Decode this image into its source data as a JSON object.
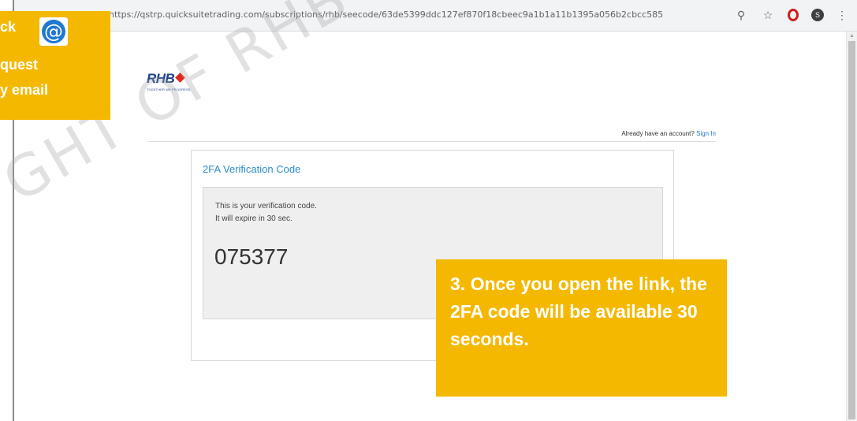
{
  "browser": {
    "url": "https://qstrp.quicksuitetrading.com/subscriptions/rhb/seecode/63de5399ddc127ef870f18cbeec9a1b1a11b1395a056b2cbcc585",
    "profile_initial": "S"
  },
  "logo": {
    "word": "RHB",
    "tagline": "TOGETHER WE PROGRESS"
  },
  "header": {
    "prompt": "Already have an account?",
    "signin": "Sign In"
  },
  "card": {
    "title": "2FA Verification Code",
    "line1": "This is your verification code.",
    "line2": "It will expire in 30 sec.",
    "code": "075377"
  },
  "watermark": "GHT OF RHB INVEST",
  "callouts": {
    "left_lines": [
      "ck",
      "quest",
      "y email"
    ],
    "right_text": "3. Once you open the link, the 2FA code will be available 30 seconds."
  },
  "colors": {
    "callout": "#f5b800",
    "accent_blue": "#2b8ccd",
    "rhb_blue": "#1b3f8b",
    "rhb_red": "#e2261f"
  }
}
